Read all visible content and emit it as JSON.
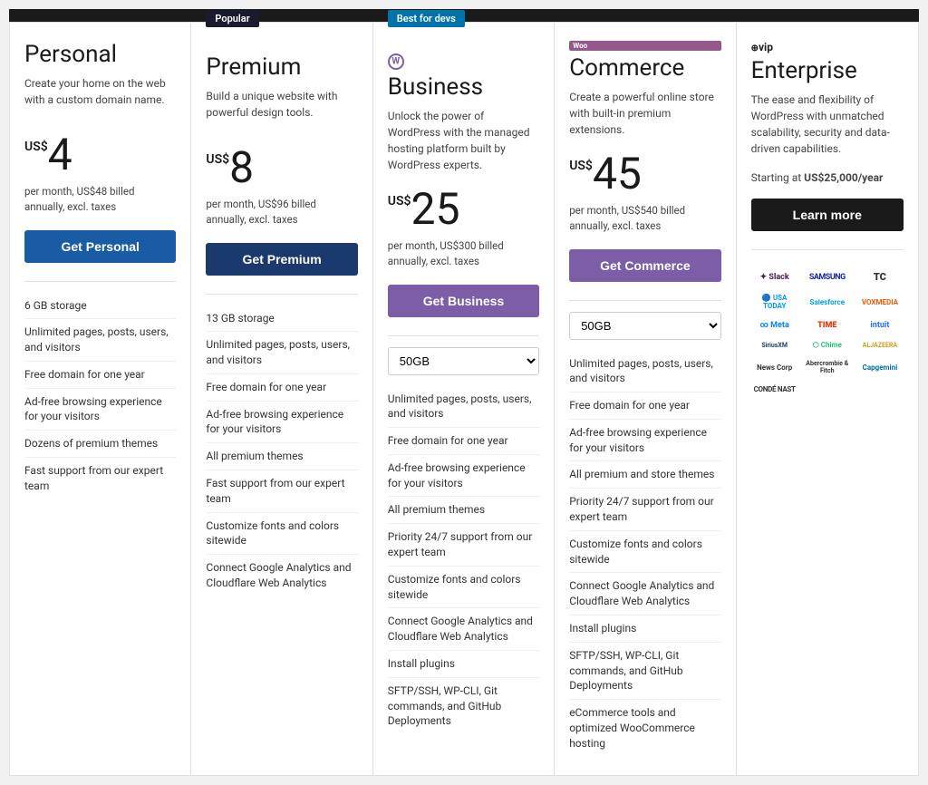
{
  "plans": [
    {
      "id": "personal",
      "badge": null,
      "icon": null,
      "name": "Personal",
      "desc": "Create your home on the web with a custom domain name.",
      "currency": "US$",
      "amount": "4",
      "billed": "per month, US$48 billed annually, excl. taxes",
      "btn_label": "Get Personal",
      "btn_class": "btn-personal",
      "storage_dropdown": false,
      "features": [
        "6 GB storage",
        "Unlimited pages, posts, users, and visitors",
        "Free domain for one year",
        "Ad-free browsing experience for your visitors",
        "Dozens of premium themes",
        "Fast support from our expert team"
      ]
    },
    {
      "id": "premium",
      "badge": "Popular",
      "badge_class": "badge-popular",
      "icon": null,
      "name": "Premium",
      "desc": "Build a unique website with powerful design tools.",
      "currency": "US$",
      "amount": "8",
      "billed": "per month, US$96 billed annually, excl. taxes",
      "btn_label": "Get Premium",
      "btn_class": "btn-premium",
      "storage_dropdown": false,
      "features": [
        "13 GB storage",
        "Unlimited pages, posts, users, and visitors",
        "Free domain for one year",
        "Ad-free browsing experience for your visitors",
        "All premium themes",
        "Fast support from our expert team",
        "Customize fonts and colors sitewide",
        "Connect Google Analytics and Cloudflare Web Analytics"
      ]
    },
    {
      "id": "business",
      "badge": "Best for devs",
      "badge_class": "badge-bestdev",
      "icon": "wp",
      "name": "Business",
      "desc": "Unlock the power of WordPress with the managed hosting platform built by WordPress experts.",
      "currency": "US$",
      "amount": "25",
      "billed": "per month, US$300 billed annually, excl. taxes",
      "btn_label": "Get Business",
      "btn_class": "btn-business",
      "storage_dropdown": true,
      "storage_value": "50GB",
      "features": [
        "Unlimited pages, posts, users, and visitors",
        "Free domain for one year",
        "Ad-free browsing experience for your visitors",
        "All premium themes",
        "Priority 24/7 support from our expert team",
        "Customize fonts and colors sitewide",
        "Connect Google Analytics and Cloudflare Web Analytics",
        "Install plugins",
        "SFTP/SSH, WP-CLI, Git commands, and GitHub Deployments"
      ]
    },
    {
      "id": "commerce",
      "badge": null,
      "icon": "woo",
      "name": "Commerce",
      "desc": "Create a powerful online store with built-in premium extensions.",
      "currency": "US$",
      "amount": "45",
      "billed": "per month, US$540 billed annually, excl. taxes",
      "btn_label": "Get Commerce",
      "btn_class": "btn-commerce",
      "storage_dropdown": true,
      "storage_value": "50GB",
      "features": [
        "Unlimited pages, posts, users, and visitors",
        "Free domain for one year",
        "Ad-free browsing experience for your visitors",
        "All premium and store themes",
        "Priority 24/7 support from our expert team",
        "Customize fonts and colors sitewide",
        "Connect Google Analytics and Cloudflare Web Analytics",
        "Install plugins",
        "SFTP/SSH, WP-CLI, Git commands, and GitHub Deployments",
        "eCommerce tools and optimized WooCommerce hosting"
      ]
    },
    {
      "id": "enterprise",
      "badge": null,
      "icon": "vip",
      "name": "Enterprise",
      "desc": "The ease and flexibility of WordPress with unmatched scalability, security and data-driven capabilities.",
      "starting_label": "Starting at US$25,000/year",
      "btn_label": "Learn more",
      "btn_class": "btn-enterprise",
      "logos": [
        {
          "name": "Slack",
          "class": "logo-slack",
          "prefix": "✦"
        },
        {
          "name": "SAMSUNG",
          "class": "logo-samsung",
          "prefix": ""
        },
        {
          "name": "TC",
          "class": "logo-tc",
          "prefix": ""
        },
        {
          "name": "USA TODAY",
          "class": "logo-usatoday",
          "prefix": "🔵"
        },
        {
          "name": "Salesforce",
          "class": "logo-sf",
          "prefix": ""
        },
        {
          "name": "VOXMEDIA",
          "class": "logo-voxmedia",
          "prefix": ""
        },
        {
          "name": "Meta",
          "class": "logo-meta",
          "prefix": "∞"
        },
        {
          "name": "TIME",
          "class": "logo-time",
          "prefix": ""
        },
        {
          "name": "intuit",
          "class": "logo-intuit",
          "prefix": ""
        },
        {
          "name": "SiriusXM",
          "class": "logo-siriusxm",
          "prefix": ""
        },
        {
          "name": "⬡ Chime",
          "class": "logo-chime",
          "prefix": ""
        },
        {
          "name": "ALJAZEERA",
          "class": "logo-aljazeera",
          "prefix": ""
        },
        {
          "name": "News Corp",
          "class": "logo-newscorp",
          "prefix": ""
        },
        {
          "name": "Abercrombie & Fitch",
          "class": "logo-abercrombie",
          "prefix": ""
        },
        {
          "name": "Capgemini",
          "class": "logo-capgemini",
          "prefix": ""
        },
        {
          "name": "CONDÉ NAST",
          "class": "logo-condenast",
          "prefix": ""
        }
      ]
    }
  ]
}
